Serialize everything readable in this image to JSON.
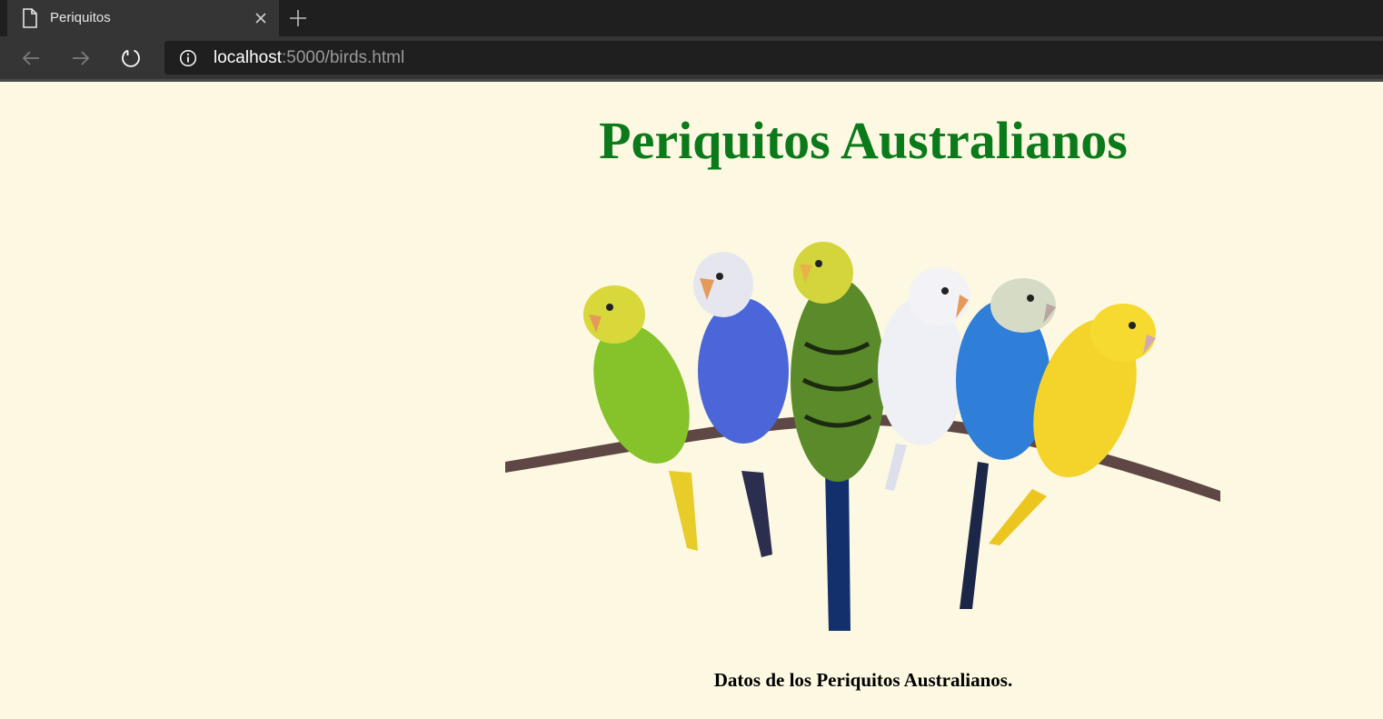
{
  "browser": {
    "tab_title": "Periquitos",
    "url_host": "localhost",
    "url_rest": ":5000/birds.html"
  },
  "page": {
    "heading": "Periquitos Australianos",
    "caption": "Datos de los Periquitos Australianos."
  },
  "colors": {
    "page_background": "#fdf8e1",
    "heading": "#0b7a1a"
  },
  "icons": {
    "tab": "document-icon",
    "close": "close-icon",
    "new_tab": "plus-icon",
    "back": "arrow-left-icon",
    "forward": "arrow-right-icon",
    "reload": "reload-icon",
    "site_info": "info-icon"
  }
}
